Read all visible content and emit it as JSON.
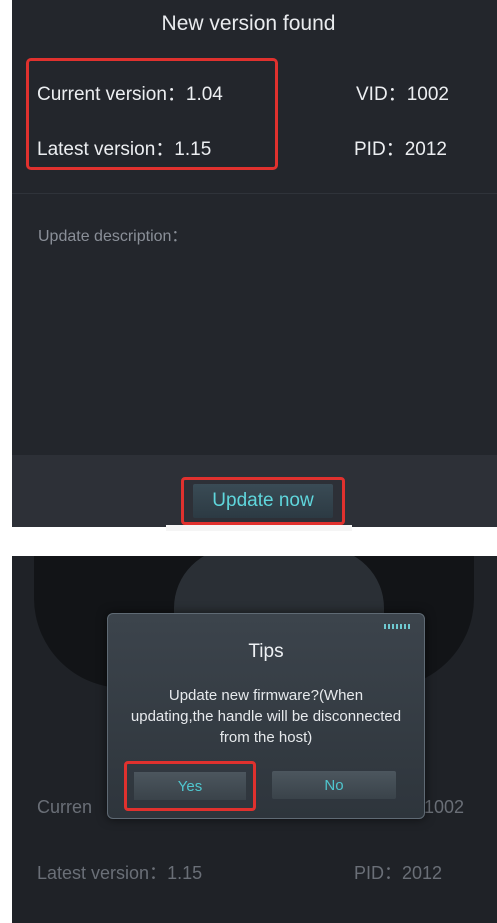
{
  "update_screen": {
    "title": "New version found",
    "current_version_label": "Current version：",
    "current_version_value": "1.04",
    "latest_version_label": "Latest version：",
    "latest_version_value": "1.15",
    "vid_label": "VID：",
    "vid_value": "1002",
    "pid_label": "PID：",
    "pid_value": "2012",
    "description_label": "Update description：",
    "update_button_label": "Update now"
  },
  "confirm_screen": {
    "bg_current_label": "Curren",
    "bg_vid_value": "1002",
    "bg_latest_label": "Latest version：",
    "bg_latest_value": "1.15",
    "bg_pid_label": "PID：",
    "bg_pid_value": "2012",
    "dialog": {
      "title": "Tips",
      "message": "Update new firmware?(When updating,the handle will be disconnected from the host)",
      "yes_label": "Yes",
      "no_label": "No"
    }
  },
  "colors": {
    "highlight_box": "#e0312e",
    "button_text": "#5fd6dc",
    "panel_background": "#23262c"
  }
}
